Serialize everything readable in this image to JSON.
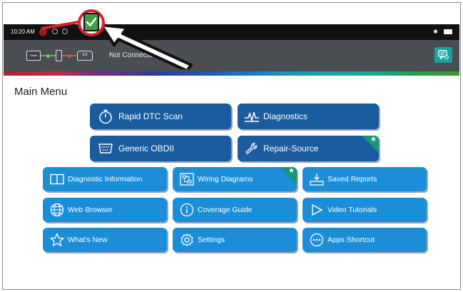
{
  "statusbar": {
    "time": "10:20 AM",
    "right_icons": [
      "bluetooth-icon",
      "battery-icon"
    ]
  },
  "header": {
    "chain_labels": {
      "tablet": "Tablet",
      "vci": "VCI",
      "car": "0.0"
    },
    "connection_status": "Not Connected",
    "chat_icon": "chat-support-icon"
  },
  "main": {
    "title": "Main Menu",
    "primary_tiles": [
      {
        "label": "Rapid DTC Scan",
        "icon": "stopwatch-icon"
      },
      {
        "label": "Diagnostics",
        "icon": "waveform-icon"
      },
      {
        "label": "Generic OBDII",
        "icon": "obd-connector-icon"
      },
      {
        "label": "Repair-Source",
        "icon": "wrench-icon",
        "badge": "★"
      }
    ],
    "secondary_tiles": [
      {
        "label": "Diagnostic Information",
        "icon": "book-icon"
      },
      {
        "label": "Wiring Diagrams",
        "icon": "wiring-diagram-icon",
        "badge": "★"
      },
      {
        "label": "Saved Reports",
        "icon": "download-tray-icon"
      },
      {
        "label": "Web Browser",
        "icon": "globe-icon"
      },
      {
        "label": "Coverage Guide",
        "icon": "info-icon"
      },
      {
        "label": "Video Tutorials",
        "icon": "play-icon"
      },
      {
        "label": "What's New",
        "icon": "star-icon"
      },
      {
        "label": "Settings",
        "icon": "gear-icon"
      },
      {
        "label": "Apps Shortcut",
        "icon": "more-dots-icon"
      }
    ]
  },
  "colors": {
    "primary_tile": "#1a5c9e",
    "secondary_tile": "#1c8ed8",
    "header": "#4a4d52",
    "badge": "#17957a",
    "callout": "#d9232b"
  }
}
